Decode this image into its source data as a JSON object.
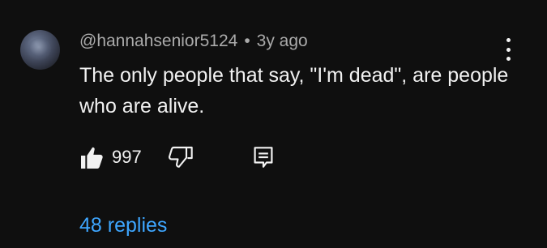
{
  "comment": {
    "author": "@hannahsenior5124",
    "separator": "•",
    "time": "3y ago",
    "text": "The only people that say, \"I'm dead\", are people who are alive.",
    "likes": "997",
    "replies_label": "48 replies",
    "icons": {
      "avatar": "user-avatar",
      "menu": "more-vertical-icon",
      "like": "thumbs-up-icon",
      "dislike": "thumbs-down-icon",
      "reply": "comment-reply-icon"
    },
    "colors": {
      "background": "#0f0f0f",
      "text": "#f1f1f1",
      "secondary_text": "#aaaaaa",
      "link": "#3ea6ff"
    }
  }
}
